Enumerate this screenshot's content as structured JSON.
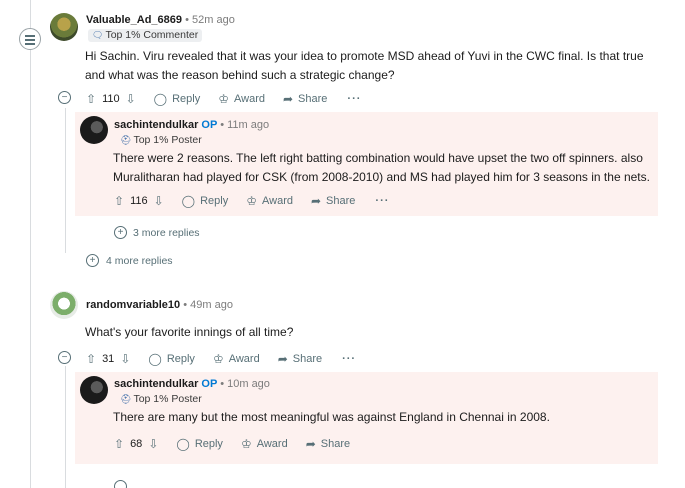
{
  "comments": [
    {
      "username": "Valuable_Ad_6869",
      "time": "52m ago",
      "flair": "Top 1% Commenter",
      "text": "Hi Sachin. Viru revealed that it was your idea to promote MSD ahead of Yuvi in the CWC final. Is that true and what was the reason behind such a strategic change?",
      "votes": "110",
      "reply": "Reply",
      "award": "Award",
      "share": "Share",
      "reply_item": {
        "username": "sachintendulkar",
        "op": "OP",
        "time": "11m ago",
        "flair": "Top 1% Poster",
        "text": "There were 2 reasons. The left right batting combination would have upset the two off spinners. also Muralitharan had played for CSK (from 2008-2010) and MS had played him for 3 seasons in the nets.",
        "votes": "116",
        "reply": "Reply",
        "award": "Award",
        "share": "Share",
        "more_replies": "3 more replies"
      },
      "more_replies": "4 more replies"
    },
    {
      "username": "randomvariable10",
      "time": "49m ago",
      "text": "What's your favorite innings of all time?",
      "votes": "31",
      "reply": "Reply",
      "award": "Award",
      "share": "Share",
      "reply_item": {
        "username": "sachintendulkar",
        "op": "OP",
        "time": "10m ago",
        "flair": "Top 1% Poster",
        "text": "There are many but the most meaningful was against England in Chennai in 2008.",
        "votes": "68",
        "reply": "Reply",
        "award": "Award",
        "share": "Share"
      }
    }
  ],
  "icons": {
    "menu": "menu-icon",
    "collapse": "collapse-icon",
    "upvote": "upvote-icon",
    "downvote": "downvote-icon",
    "reply": "reply-bubble-icon",
    "award": "award-icon",
    "share": "share-icon",
    "more": "more-options-icon",
    "expand": "expand-plus-icon",
    "flair": "flair-badge-icon"
  },
  "colors": {
    "op": "#0079d3",
    "highlight": "#fdf1ef",
    "thread_line": "#d9dcdf",
    "muted": "#7c7c7c"
  }
}
